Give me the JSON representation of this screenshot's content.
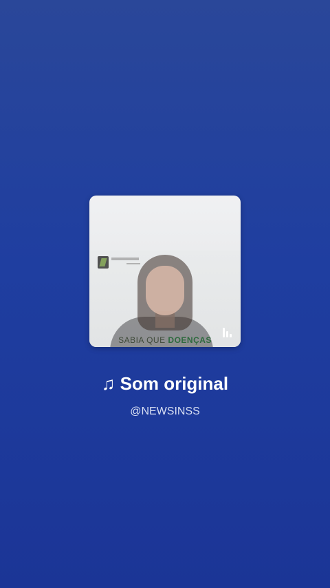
{
  "audio": {
    "note_icon": "♫",
    "title": "Som original",
    "author": "@NEWSINSS"
  },
  "cover": {
    "caption_normal": "SABIA QUE ",
    "caption_bold": "DOENÇAS",
    "accent_color": "#2e6a3e"
  },
  "colors": {
    "background_top": "#2a4799",
    "background_bottom": "#1b3596",
    "title_color": "#ffffff",
    "subtitle_color": "#d7def2"
  }
}
